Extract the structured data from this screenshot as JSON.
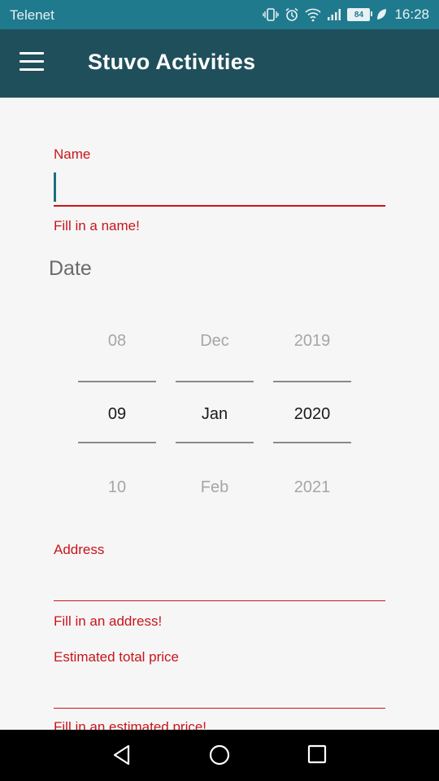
{
  "status_bar": {
    "carrier": "Telenet",
    "battery": "84",
    "time": "16:28"
  },
  "app_bar": {
    "title": "Stuvo Activities"
  },
  "form": {
    "name": {
      "label": "Name",
      "value": "",
      "error": "Fill in a name!"
    },
    "date": {
      "heading": "Date",
      "day": {
        "prev": "08",
        "selected": "09",
        "next": "10"
      },
      "month": {
        "prev": "Dec",
        "selected": "Jan",
        "next": "Feb"
      },
      "year": {
        "prev": "2019",
        "selected": "2020",
        "next": "2021"
      }
    },
    "address": {
      "label": "Address",
      "value": "",
      "error": "Fill in an address!"
    },
    "price": {
      "label": "Estimated total price",
      "value": "",
      "error": "Fill in an estimated price!"
    }
  },
  "colors": {
    "status_bar": "#207a8e",
    "app_bar": "#1f4f5b",
    "error": "#c8151b",
    "background": "#f6f6f6"
  }
}
